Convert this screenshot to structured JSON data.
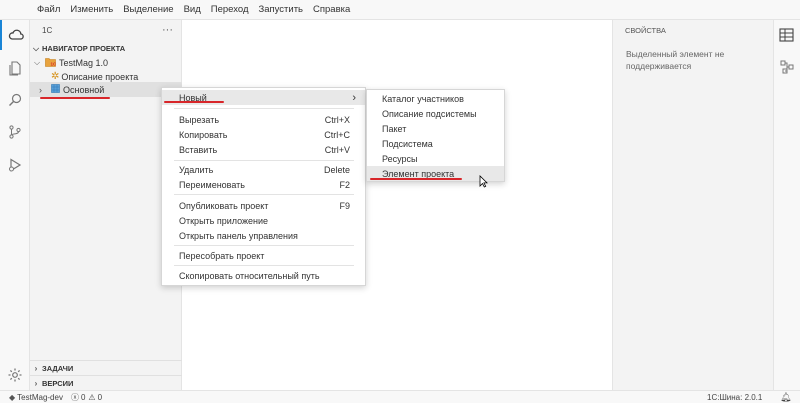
{
  "menubar": {
    "items": [
      "Файл",
      "Изменить",
      "Выделение",
      "Вид",
      "Переход",
      "Запустить",
      "Справка"
    ]
  },
  "activity": {
    "items": [
      "cloud-icon",
      "files-icon",
      "search-icon",
      "source-control-icon",
      "run-debug-icon",
      "settings-gear-icon"
    ]
  },
  "sidebar": {
    "header": "1C",
    "more": "···",
    "section_title": "НАВИГАТОР ПРОЕКТА",
    "project_name": "TestMag 1.0",
    "project_description": "Описание проекта",
    "subsystem": "Основной",
    "tasks_section": "ЗАДАЧИ",
    "versions_section": "ВЕРСИИ"
  },
  "properties": {
    "title": "СВОЙСТВА",
    "message": "Выделенный элемент не поддерживается"
  },
  "context_menu": {
    "new": "Новый",
    "cut": "Вырезать",
    "cut_shortcut": "Ctrl+X",
    "copy": "Копировать",
    "copy_shortcut": "Ctrl+C",
    "paste": "Вставить",
    "paste_shortcut": "Ctrl+V",
    "delete": "Удалить",
    "delete_shortcut": "Delete",
    "rename": "Переименовать",
    "rename_shortcut": "F2",
    "publish": "Опубликовать проект",
    "publish_shortcut": "F9",
    "open_app": "Открыть приложение",
    "open_panel": "Открыть панель управления",
    "rebuild": "Пересобрать проект",
    "copy_path": "Скопировать относительный путь"
  },
  "submenu": {
    "items": [
      "Каталог участников",
      "Описание подсистемы",
      "Пакет",
      "Подсистема",
      "Ресурсы",
      "Элемент проекта"
    ]
  },
  "status": {
    "branch": "TestMag-dev",
    "errors": "0",
    "warnings": "0",
    "version": "1С:Шина: 2.0.1"
  },
  "colors": {
    "accent": "#1a85d6",
    "annotation": "#d8262a"
  }
}
